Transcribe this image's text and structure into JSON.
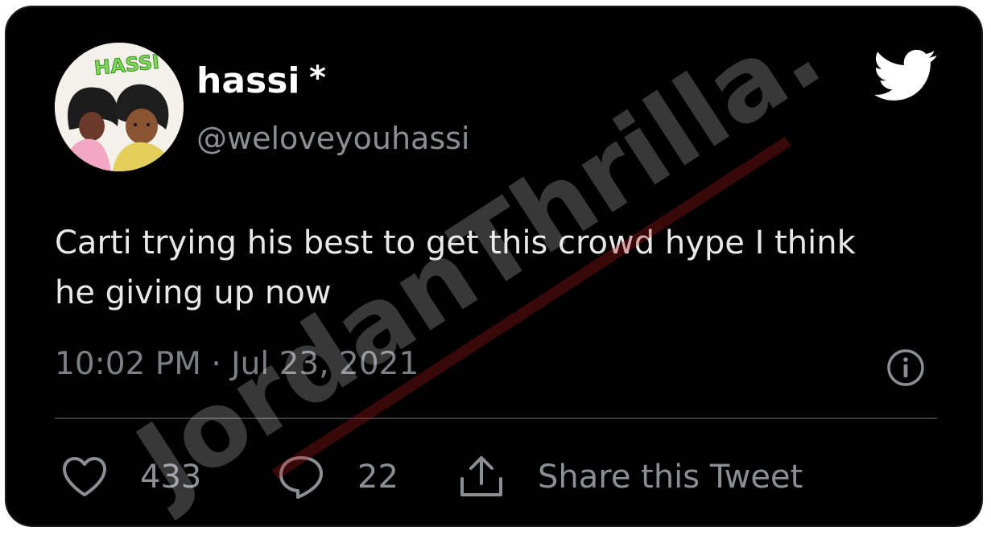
{
  "tweet": {
    "author": {
      "display_name": "hassi",
      "name_mark": "*",
      "handle": "@weloveyouhassi",
      "avatar_text": "HASSI"
    },
    "text_lines": [
      "Carti trying his best to get this crowd hype I think",
      "he giving up now"
    ],
    "timestamp": "10:02 PM · Jul 23, 2021",
    "actions": {
      "like_count": "433",
      "reply_count": "22",
      "share_label": "Share this Tweet"
    }
  },
  "watermark": {
    "text": "JordanThrilla."
  },
  "colors": {
    "card_background": "#000000",
    "primary_text": "#ffffff",
    "secondary_text": "#8b8f94",
    "divider": "#3a3d40",
    "watermark_red": "#b01818"
  },
  "icons": {
    "brand": "twitter-bird-icon",
    "info": "info-icon",
    "like": "heart-icon",
    "reply": "speech-bubble-icon",
    "share": "share-upload-icon"
  }
}
